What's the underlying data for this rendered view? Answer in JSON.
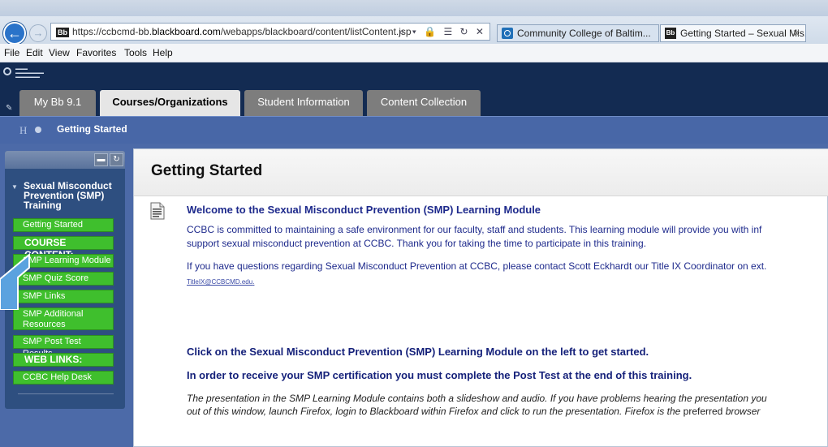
{
  "browser": {
    "url_prefix": "https://ccbcmd-bb.",
    "url_domain": "blackboard.com",
    "url_path": "/webapps/blackboard/content/listContent.jsp",
    "url_icons": "⌕ ▾ 🔒 ☰ ↻ ✕",
    "tabs": [
      {
        "label": "Community College of Baltim..."
      },
      {
        "label": "Getting Started – Sexual Mis...",
        "close": "✕"
      }
    ],
    "menu": [
      "File",
      "Edit",
      "View",
      "Favorites",
      "Tools",
      "Help"
    ]
  },
  "bb": {
    "main_tabs": [
      "My Bb 9.1",
      "Courses/Organizations",
      "Student Information",
      "Content Collection"
    ],
    "breadcrumb": "Getting Started",
    "breadcrumb_home": "H"
  },
  "course": {
    "title": "Sexual Misconduct Prevention (SMP) Training",
    "menu": [
      {
        "label": "Getting Started",
        "type": "link"
      },
      {
        "label": "COURSE CONTENT:",
        "type": "header"
      },
      {
        "label": "SMP Learning Module",
        "type": "link"
      },
      {
        "label": "SMP Quiz Score",
        "type": "link"
      },
      {
        "label": "SMP Links",
        "type": "link"
      },
      {
        "label": "SMP Additional Resources",
        "type": "link"
      },
      {
        "label": "SMP Post Test Results",
        "type": "link"
      },
      {
        "label": "WEB LINKS:",
        "type": "header"
      },
      {
        "label": "CCBC Help Desk",
        "type": "link"
      }
    ]
  },
  "content": {
    "title": "Getting Started",
    "welcome_heading": "Welcome to the Sexual Misconduct Prevention (SMP) Learning Module",
    "para1_line1": "CCBC is committed to maintaining a safe environment for our faculty, staff and students. This learning module will provide you with inf",
    "para1_line2": "support sexual misconduct prevention at CCBC.  Thank you for taking the time to participate in this training.",
    "para2_line1": "If you have questions regarding  Sexual Misconduct Prevention at CCBC, please contact Scott Eckhardt our Title IX Coordinator on ext.",
    "email": "TitleIX@CCBCMD.edu",
    "email_suffix": ".",
    "click_msg": "Click on the Sexual Misconduct Prevention (SMP)  Learning Module on the left to get started.",
    "cert_msg": "In order to receive your SMP certification you must complete the Post Test at the end of this training.",
    "note_line1": "The presentation in the SMP Learning Module contains both a slideshow and audio.  If you have problems hearing the presentation you",
    "note_line2_a": "out of this window, launch Firefox, login to Blackboard within Firefox and click to run the presentation.  Firefox is the ",
    "note_line2_b": "preferred",
    "note_line2_c": " browser"
  }
}
